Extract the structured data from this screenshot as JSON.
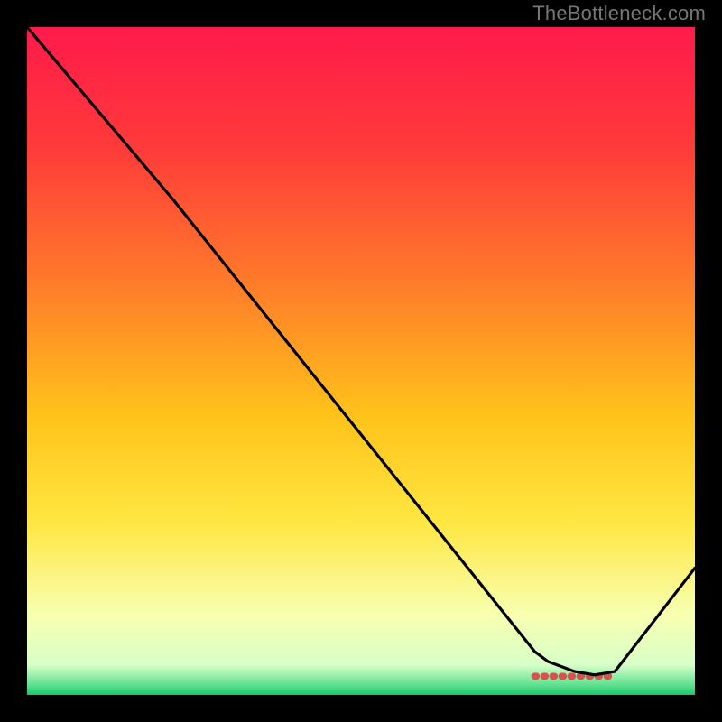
{
  "attribution": "TheBottleneck.com",
  "chart_data": {
    "type": "line",
    "title": "",
    "xlabel": "",
    "ylabel": "",
    "xlim": [
      0,
      100
    ],
    "ylim": [
      0,
      100
    ],
    "series": [
      {
        "name": "curve",
        "x": [
          0,
          22,
          76,
          78,
          82,
          85,
          88,
          100
        ],
        "y": [
          100,
          74,
          6.5,
          5,
          3.5,
          3,
          3.5,
          19
        ]
      }
    ],
    "marker": {
      "x_start": 76,
      "x_end": 88,
      "y": 2.8
    },
    "gradient_stops": [
      {
        "offset": 0.0,
        "color": "#ff1a4b"
      },
      {
        "offset": 0.18,
        "color": "#ff3a3a"
      },
      {
        "offset": 0.38,
        "color": "#ff7a2a"
      },
      {
        "offset": 0.58,
        "color": "#ffc21a"
      },
      {
        "offset": 0.74,
        "color": "#ffe640"
      },
      {
        "offset": 0.88,
        "color": "#f7ffb0"
      },
      {
        "offset": 0.955,
        "color": "#d8ffc8"
      },
      {
        "offset": 0.985,
        "color": "#60e090"
      },
      {
        "offset": 1.0,
        "color": "#18c868"
      }
    ]
  }
}
